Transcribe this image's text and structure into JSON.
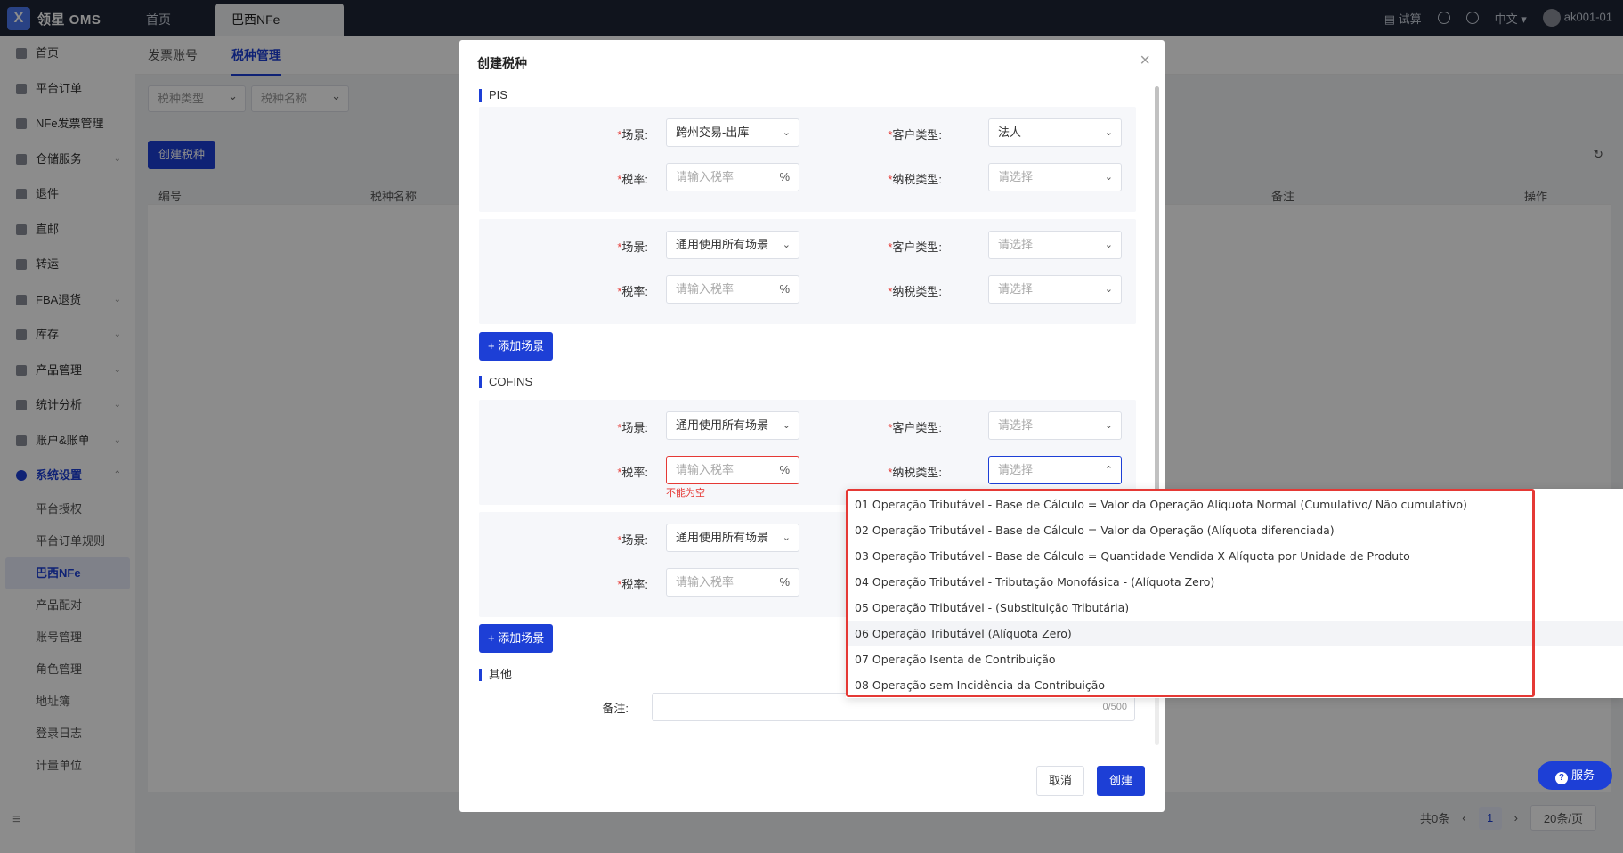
{
  "app": {
    "logo_text": "领星 OMS",
    "logo_mark": "X"
  },
  "top_tabs": [
    {
      "label": "首页"
    },
    {
      "label": "巴西NFe"
    }
  ],
  "top_right": {
    "trial": "试算",
    "language": "中文",
    "user": "ak001-01"
  },
  "sidebar": {
    "items": [
      {
        "label": "首页"
      },
      {
        "label": "平台订单"
      },
      {
        "label": "NFe发票管理"
      },
      {
        "label": "仓储服务"
      },
      {
        "label": "退件"
      },
      {
        "label": "直邮"
      },
      {
        "label": "转运"
      },
      {
        "label": "FBA退货"
      },
      {
        "label": "库存"
      },
      {
        "label": "产品管理"
      },
      {
        "label": "统计分析"
      },
      {
        "label": "账户&账单"
      },
      {
        "label": "系统设置"
      }
    ],
    "sub_items": [
      {
        "label": "平台授权"
      },
      {
        "label": "平台订单规则"
      },
      {
        "label": "巴西NFe"
      },
      {
        "label": "产品配对"
      },
      {
        "label": "账号管理"
      },
      {
        "label": "角色管理"
      },
      {
        "label": "地址簿"
      },
      {
        "label": "登录日志"
      },
      {
        "label": "计量单位"
      }
    ],
    "collapse_icon": "≡"
  },
  "subtabs": [
    {
      "label": "发票账号"
    },
    {
      "label": "税种管理"
    }
  ],
  "filters": {
    "tax_type": "税种类型",
    "tax_name": "税种名称"
  },
  "toolbar": {
    "create_label": "创建税种"
  },
  "table": {
    "columns": [
      "编号",
      "税种名称",
      "备注",
      "操作"
    ]
  },
  "pagination": {
    "total": "共0条",
    "page": "1",
    "page_size": "20条/页"
  },
  "dialog": {
    "title": "创建税种",
    "close": "×",
    "pis": {
      "title": "PIS",
      "scene_1": {
        "scene_label": "场景:",
        "scene_value": "跨州交易-出库",
        "customer_label": "客户类型:",
        "customer_value": "法人",
        "rate_label": "税率:",
        "rate_placeholder": "请输入税率",
        "rate_unit": "%",
        "taxpayer_label": "纳税类型:",
        "taxpayer_placeholder": "请选择"
      },
      "scene_2": {
        "scene_label": "场景:",
        "scene_value": "通用使用所有场景",
        "customer_label": "客户类型:",
        "customer_placeholder": "请选择",
        "rate_label": "税率:",
        "rate_placeholder": "请输入税率",
        "rate_unit": "%",
        "taxpayer_label": "纳税类型:",
        "taxpayer_placeholder": "请选择"
      },
      "add_scene": "+ 添加场景"
    },
    "cofins": {
      "title": "COFINS",
      "scene_1": {
        "scene_label": "场景:",
        "scene_value": "通用使用所有场景",
        "customer_label": "客户类型:",
        "customer_placeholder": "请选择",
        "rate_label": "税率:",
        "rate_placeholder": "请输入税率",
        "rate_unit": "%",
        "rate_error": "不能为空",
        "taxpayer_label": "纳税类型:",
        "taxpayer_placeholder": "请选择"
      },
      "scene_2": {
        "scene_label": "场景:",
        "scene_value": "通用使用所有场景",
        "rate_label": "税率:",
        "rate_placeholder": "请输入税率",
        "rate_unit": "%"
      },
      "add_scene": "+ 添加场景"
    },
    "other": {
      "title": "其他",
      "remark_label": "备注:",
      "remark_count": "0/500"
    },
    "cancel": "取消",
    "confirm": "创建"
  },
  "taxpayer_dropdown": {
    "hovered_index": 5,
    "options": [
      "01 Operação Tributável - Base de Cálculo = Valor da Operação Alíquota Normal (Cumulativo/ Não cumulativo)",
      "02 Operação Tributável - Base de Cálculo = Valor da Operação (Alíquota diferenciada)",
      "03 Operação Tributável - Base de Cálculo = Quantidade Vendida X Alíquota por Unidade de Produto",
      "04 Operação Tributável - Tributação Monofásica - (Alíquota Zero)",
      "05 Operação Tributável - (Substituição Tributária)",
      "06 Operação Tributável (Alíquota Zero)",
      "07 Operação Isenta de Contribuição",
      "08 Operação sem Incidência da Contribuição"
    ]
  },
  "service_button": "服务",
  "colors": {
    "primary": "#1d3fd6",
    "topbar": "#1e2535",
    "error": "#e53935"
  }
}
